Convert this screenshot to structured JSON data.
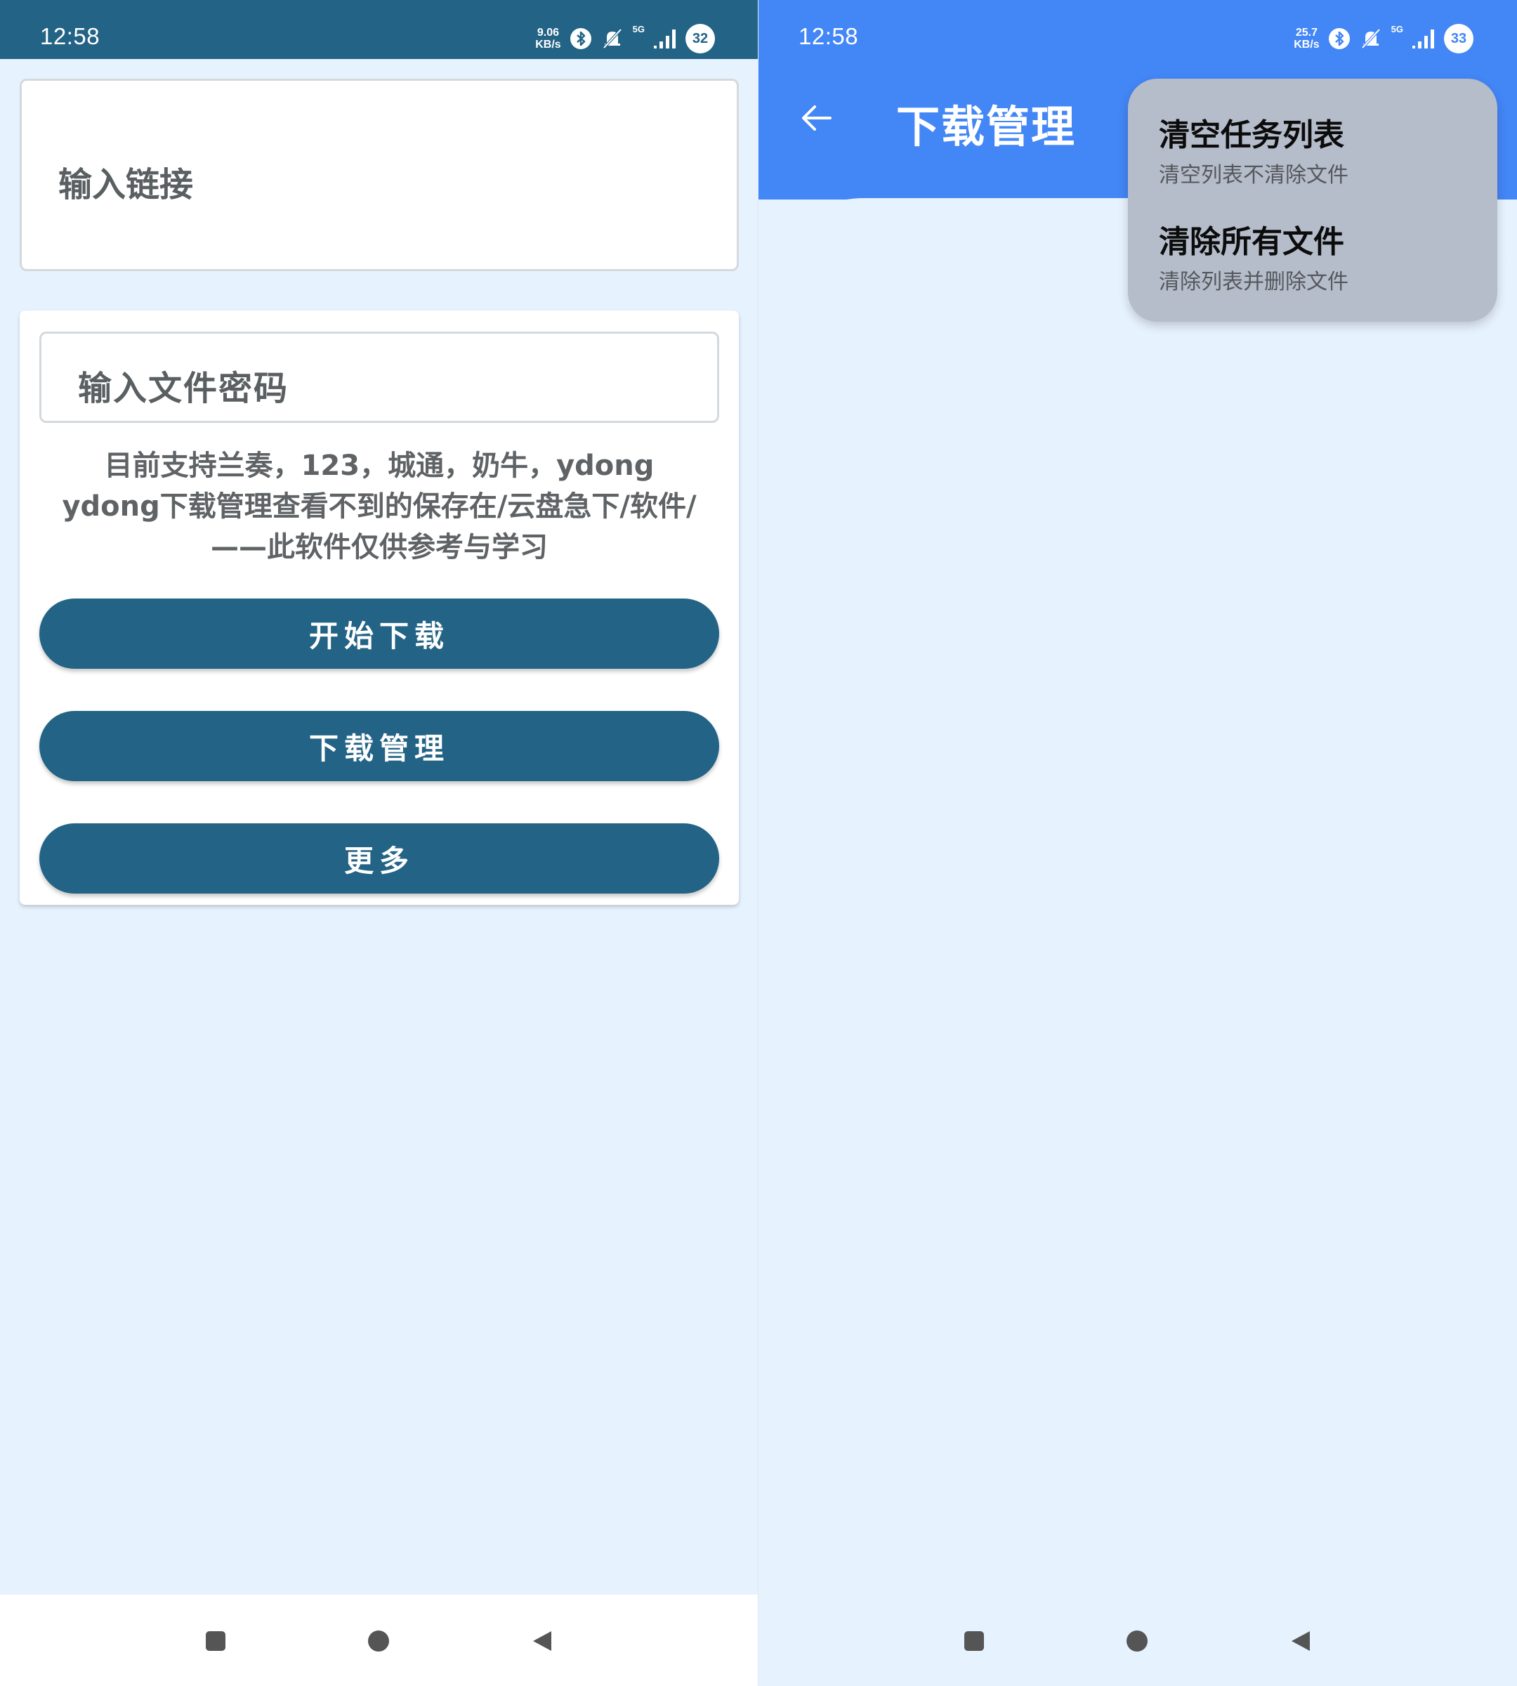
{
  "left": {
    "status": {
      "time": "12:58",
      "speed_value": "9.06",
      "speed_unit": "KB/s",
      "network": "5G",
      "battery": "32"
    },
    "link_input": {
      "placeholder": "输入链接"
    },
    "password_input": {
      "placeholder": "输入文件密码"
    },
    "info_lines": [
      "目前支持兰奏，123，城通，奶牛，ydong",
      "ydong下载管理查看不到的保存在/云盘急下/软件/",
      "——此软件仅供参考与学习"
    ],
    "buttons": {
      "start": "开始下载",
      "manage": "下载管理",
      "more": "更多"
    }
  },
  "right": {
    "status": {
      "time": "12:58",
      "speed_value": "25.7",
      "speed_unit": "KB/s",
      "network": "5G",
      "battery": "33"
    },
    "title": "下载管理",
    "menu": [
      {
        "title": "清空任务列表",
        "subtitle": "清空列表不清除文件"
      },
      {
        "title": "清除所有文件",
        "subtitle": "清除列表并删除文件"
      }
    ]
  },
  "colors": {
    "primary_dark": "#236386",
    "primary_blue": "#4386f6",
    "background": "#e6f2fe",
    "menu_bg": "#b5bcca"
  },
  "icons": [
    "back-arrow-icon",
    "recent-apps-icon",
    "home-icon",
    "back-icon",
    "bluetooth-icon",
    "mute-bell-icon",
    "signal-icon"
  ]
}
